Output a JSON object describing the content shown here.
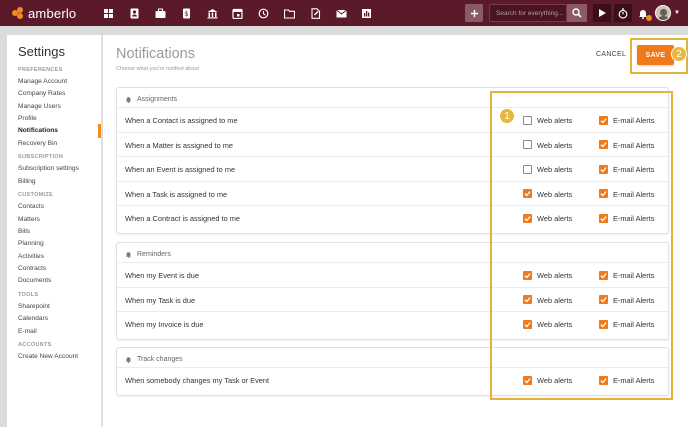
{
  "app": {
    "brand": "amberlo"
  },
  "topbar": {
    "nav_icons": [
      "dashboard-icon",
      "contacts-icon",
      "matters-icon",
      "bills-icon",
      "company-icon",
      "calendar-icon",
      "activities-icon",
      "folder-icon",
      "documents-icon",
      "mail-icon",
      "reports-icon"
    ],
    "search_placeholder": "Search for everything...",
    "colors": {
      "bar": "#5b1a2a",
      "accent": "#f28c1e"
    }
  },
  "sidebar": {
    "title": "Settings",
    "sections": [
      {
        "heading": "PREFERENCES",
        "items": [
          "Manage Account",
          "Company Rates",
          "Manage Users",
          "Profile",
          "Notifications",
          "Recovery Bin"
        ]
      },
      {
        "heading": "SUBSCRIPTION",
        "items": [
          "Subscription settings",
          "Billing"
        ]
      },
      {
        "heading": "CUSTOMIZE",
        "items": [
          "Contacts",
          "Matters",
          "Bills",
          "Planning",
          "Activities",
          "Contracts",
          "Documents"
        ]
      },
      {
        "heading": "TOOLS",
        "items": [
          "Sharepoint",
          "Calendars",
          "E-mail"
        ]
      },
      {
        "heading": "ACCOUNTS",
        "items": [
          "Create New Account"
        ]
      }
    ],
    "active_item": "Notifications"
  },
  "main": {
    "title": "Notifications",
    "subtitle": "Choose what you're notified about",
    "cancel_label": "CANCEL",
    "save_label": "SAVE",
    "step_badges": [
      "1",
      "2"
    ],
    "web_label": "Web alerts",
    "email_label": "E-mail Alerts",
    "groups": [
      {
        "title": "Assignments",
        "rows": [
          {
            "label": "When a Contact is assigned to me",
            "web": false,
            "email": true
          },
          {
            "label": "When a Matter is assigned to me",
            "web": false,
            "email": true
          },
          {
            "label": "When an Event is assigned to me",
            "web": false,
            "email": true
          },
          {
            "label": "When a Task is assigned to me",
            "web": true,
            "email": true
          },
          {
            "label": "When a Contract is assigned to me",
            "web": true,
            "email": true
          }
        ]
      },
      {
        "title": "Reminders",
        "rows": [
          {
            "label": "When my Event is due",
            "web": true,
            "email": true
          },
          {
            "label": "When my Task is due",
            "web": true,
            "email": true
          },
          {
            "label": "When my Invoice is due",
            "web": true,
            "email": true
          }
        ]
      },
      {
        "title": "Track changes",
        "rows": [
          {
            "label": "When somebody changes my Task or Event",
            "web": true,
            "email": true
          }
        ]
      }
    ],
    "colors": {
      "checkbox": "#f07a1a",
      "highlight": "#e2b23a"
    }
  }
}
